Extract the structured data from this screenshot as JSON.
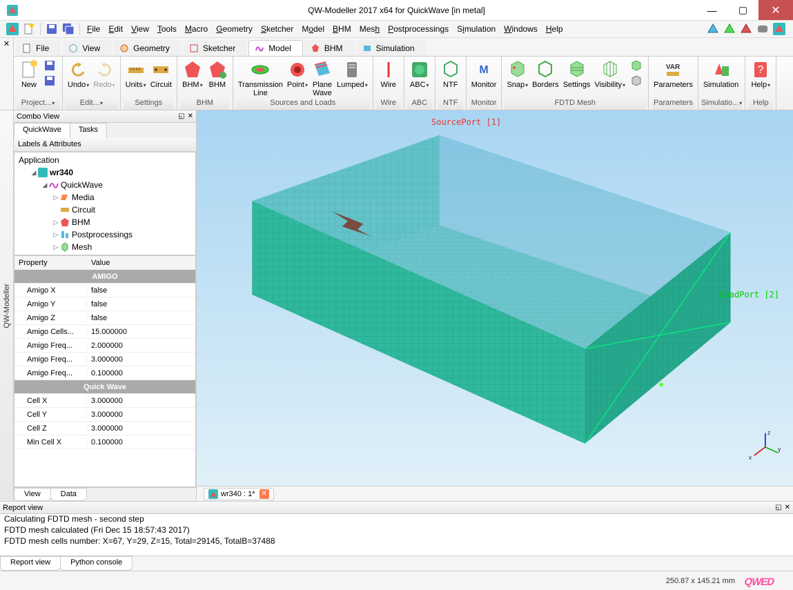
{
  "title": "QW-Modeller 2017 x64 for QuickWave [in metal]",
  "menus": [
    "File",
    "Edit",
    "View",
    "Tools",
    "Macro",
    "Geometry",
    "Sketcher",
    "Model",
    "BHM",
    "Mesh",
    "Postprocessings",
    "Simulation",
    "Windows",
    "Help"
  ],
  "ribbon_tabs": [
    {
      "label": "File"
    },
    {
      "label": "View"
    },
    {
      "label": "Geometry"
    },
    {
      "label": "Sketcher"
    },
    {
      "label": "Model",
      "active": true
    },
    {
      "label": "BHM"
    },
    {
      "label": "Simulation"
    }
  ],
  "ribbon_groups": {
    "project": {
      "label": "Project...",
      "new": "New"
    },
    "edit": {
      "label": "Edit...",
      "undo": "Undo",
      "redo": "Redo"
    },
    "settings": {
      "label": "Settings",
      "units": "Units",
      "circuit": "Circuit"
    },
    "bhm": {
      "label": "BHM",
      "bhm1": "BHM",
      "bhm2": "BHM"
    },
    "sources": {
      "label": "Sources and Loads",
      "trans": "Transmission\nLine",
      "point": "Point",
      "plane": "Plane\nWave",
      "lumped": "Lumped"
    },
    "wire": {
      "label": "Wire",
      "wire": "Wire"
    },
    "abc": {
      "label": "ABC",
      "abc": "ABC"
    },
    "ntf": {
      "label": "NTF",
      "ntf": "NTF"
    },
    "monitor": {
      "label": "Monitor",
      "mon": "Monitor"
    },
    "fdtd": {
      "label": "FDTD Mesh",
      "snap": "Snap",
      "borders": "Borders",
      "set": "Settings",
      "vis": "Visibility"
    },
    "params": {
      "label": "Parameters",
      "param": "Parameters",
      "var": "VAR"
    },
    "sim": {
      "label": "Simulatio...",
      "sim": "Simulation"
    },
    "help": {
      "label": "Help",
      "help": "Help"
    }
  },
  "combo": {
    "title": "Combo View",
    "tabs": [
      "QuickWave",
      "Tasks"
    ],
    "labels_hdr": "Labels & Attributes",
    "tree": {
      "app": "Application",
      "proj": "wr340",
      "qw": "QuickWave",
      "media": "Media",
      "circuit": "Circuit",
      "bhm": "BHM",
      "post": "Postprocessings",
      "mesh": "Mesh"
    },
    "prop_hdr_name": "Property",
    "prop_hdr_val": "Value",
    "cat1": "AMIGO",
    "cat2": "Quick Wave",
    "props": [
      {
        "n": "Amigo X",
        "v": "false"
      },
      {
        "n": "Amigo Y",
        "v": "false"
      },
      {
        "n": "Amigo Z",
        "v": "false"
      },
      {
        "n": "Amigo Cells...",
        "v": "15.000000"
      },
      {
        "n": "Amigo Freq...",
        "v": "2.000000"
      },
      {
        "n": "Amigo Freq...",
        "v": "3.000000"
      },
      {
        "n": "Amigo Freq...",
        "v": "0.100000"
      }
    ],
    "props2": [
      {
        "n": "Cell X",
        "v": "3.000000"
      },
      {
        "n": "Cell Y",
        "v": "3.000000"
      },
      {
        "n": "Cell Z",
        "v": "3.000000"
      },
      {
        "n": "Min Cell X",
        "v": "0.100000"
      }
    ],
    "btabs": [
      "View",
      "Data"
    ]
  },
  "viewport": {
    "source_port": "SourcePort [1]",
    "load_port": "LoadPort [2]",
    "doc": "wr340 : 1*"
  },
  "report": {
    "title": "Report view",
    "lines": [
      "Calculating FDTD mesh - second step",
      "FDTD mesh calculated (Fri Dec 15 18:57:43 2017)",
      "FDTD mesh cells number: X=67, Y=29, Z=15, Total=29145, TotalB=37488"
    ],
    "tabs": [
      "Report view",
      "Python console"
    ]
  },
  "status_dims": "250.87 x 145.21 mm",
  "sidebar_label": "QW-Modeller"
}
